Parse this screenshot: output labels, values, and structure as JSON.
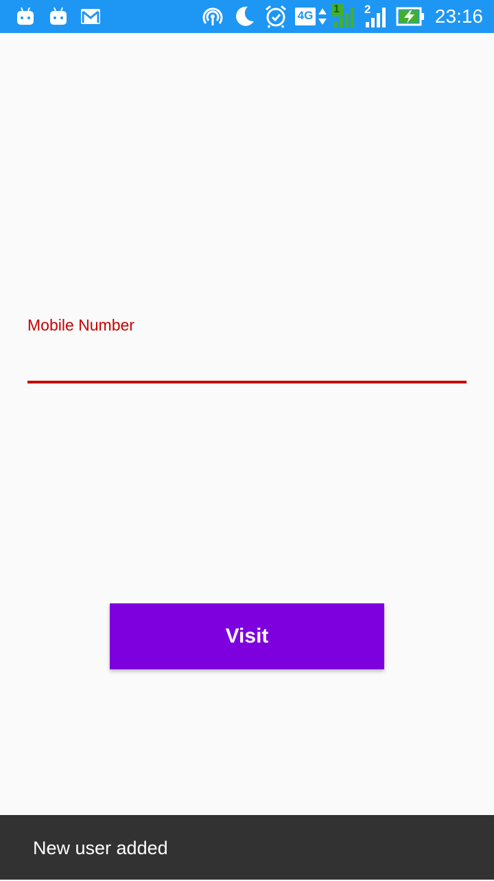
{
  "status_bar": {
    "time": "23:16",
    "network_label": "4G",
    "sim1_label": "1",
    "sim2_label": "2",
    "icons": [
      "android-icon",
      "android-icon",
      "gmail-icon",
      "hotspot-icon",
      "do-not-disturb-moon-icon",
      "alarm-icon",
      "4g-data-icon",
      "signal-sim1-icon",
      "signal-sim2-icon",
      "battery-charging-icon"
    ],
    "background_color": "#1e96f3"
  },
  "form": {
    "mobile_label": "Mobile Number",
    "mobile_value": "",
    "accent_color": "#c80000"
  },
  "actions": {
    "visit_label": "Visit",
    "button_color": "#7f00df"
  },
  "snackbar": {
    "message": "New user added",
    "background_color": "#323232"
  }
}
